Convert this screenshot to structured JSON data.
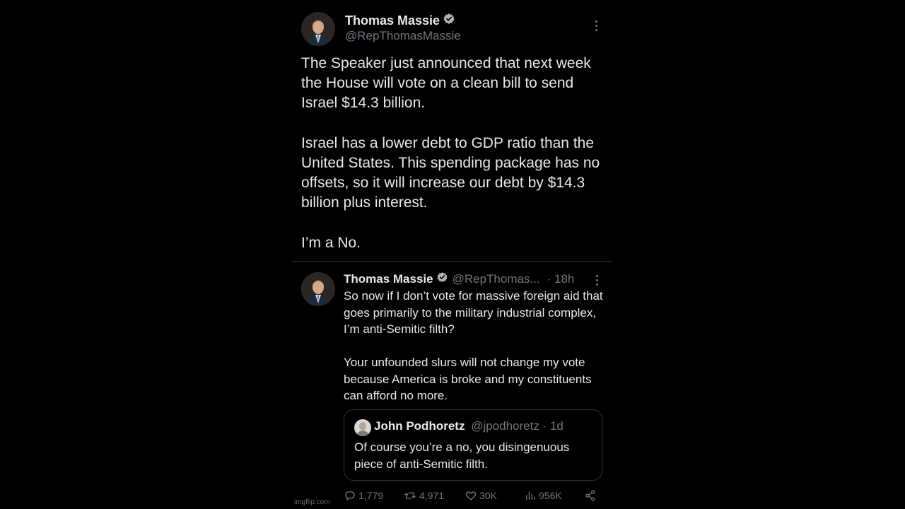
{
  "main_tweet": {
    "author_name": "Thomas Massie",
    "author_handle": "@RepThomasMassie",
    "paragraphs": [
      "The Speaker just announced that next week the House will vote on a clean bill to send Israel $14.3 billion.",
      "Israel has a lower debt to GDP ratio than the United States. This spending package has no offsets, so it will increase our debt by $14.3 billion plus interest.",
      "I’m a No."
    ]
  },
  "reply_tweet": {
    "author_name": "Thomas Massie",
    "author_handle": "@RepThomas...",
    "time": "· 18h",
    "paragraphs": [
      "So now if I don’t vote for massive foreign aid that goes primarily to the military industrial complex, I’m anti-Semitic filth?",
      "Your unfounded slurs will not change my vote because America is broke and my constituents can afford no more."
    ],
    "quote": {
      "author_name": "John Podhoretz",
      "author_meta": "@jpodhoretz · 1d",
      "text": "Of course you’re a no, you disingenuous piece of anti-Semitic filth."
    },
    "actions": {
      "replies": "1,779",
      "reposts": "4,971",
      "likes": "30K",
      "views": "956K"
    }
  },
  "icons": {
    "verified": "verified-badge-icon",
    "more": "more-icon",
    "reply": "reply-icon",
    "repost": "repost-icon",
    "like": "heart-icon",
    "views": "views-icon",
    "share": "share-icon"
  },
  "colors": {
    "background": "#000000",
    "text": "#e7e9ea",
    "muted": "#71767b",
    "border": "#2f3336",
    "verified": "#1d9bf0"
  },
  "watermark": "imgflip.com"
}
